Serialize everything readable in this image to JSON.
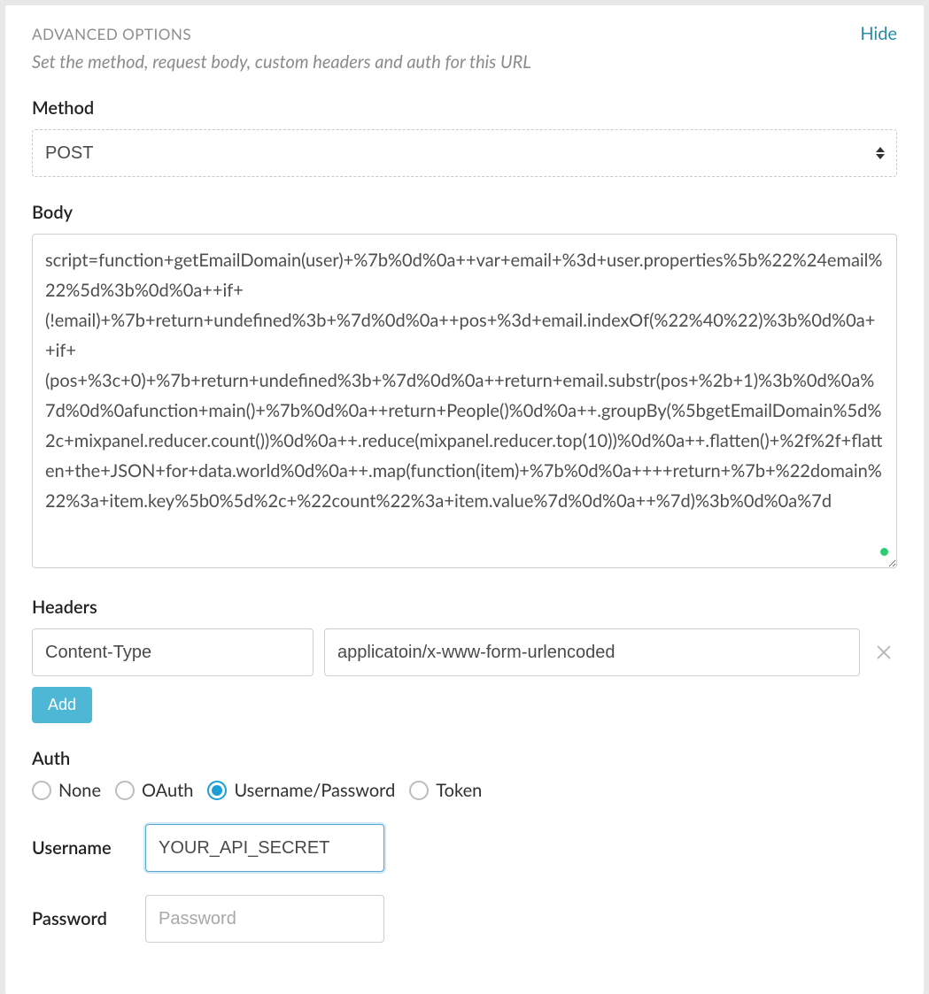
{
  "header": {
    "title": "ADVANCED OPTIONS",
    "hide_label": "Hide",
    "subtitle": "Set the method, request body, custom headers and auth for this URL"
  },
  "method": {
    "label": "Method",
    "value": "POST"
  },
  "body": {
    "label": "Body",
    "value": "script=function+getEmailDomain(user)+%7b%0d%0a++var+email+%3d+user.properties%5b%22%24email%22%5d%3b%0d%0a++if+(!email)+%7b+return+undefined%3b+%7d%0d%0a++pos+%3d+email.indexOf(%22%40%22)%3b%0d%0a++if+(pos+%3c+0)+%7b+return+undefined%3b+%7d%0d%0a++return+email.substr(pos+%2b+1)%3b%0d%0a%7d%0d%0afunction+main()+%7b%0d%0a++return+People()%0d%0a++.groupBy(%5bgetEmailDomain%5d%2c+mixpanel.reducer.count())%0d%0a++.reduce(mixpanel.reducer.top(10))%0d%0a++.flatten()+%2f%2f+flatten+the+JSON+for+data.world%0d%0a++.map(function(item)+%7b%0d%0a++++return+%7b+%22domain%22%3a+item.key%5b0%5d%2c+%22count%22%3a+item.value%7d%0d%0a++%7d)%3b%0d%0a%7d"
  },
  "headers": {
    "label": "Headers",
    "rows": [
      {
        "key": "Content-Type",
        "value": "applicatoin/x-www-form-urlencoded"
      }
    ],
    "add_label": "Add"
  },
  "auth": {
    "label": "Auth",
    "options": [
      {
        "label": "None",
        "selected": false
      },
      {
        "label": "OAuth",
        "selected": false
      },
      {
        "label": "Username/Password",
        "selected": true
      },
      {
        "label": "Token",
        "selected": false
      }
    ],
    "username_label": "Username",
    "username_value": "YOUR_API_SECRET",
    "password_label": "Password",
    "password_placeholder": "Password"
  }
}
